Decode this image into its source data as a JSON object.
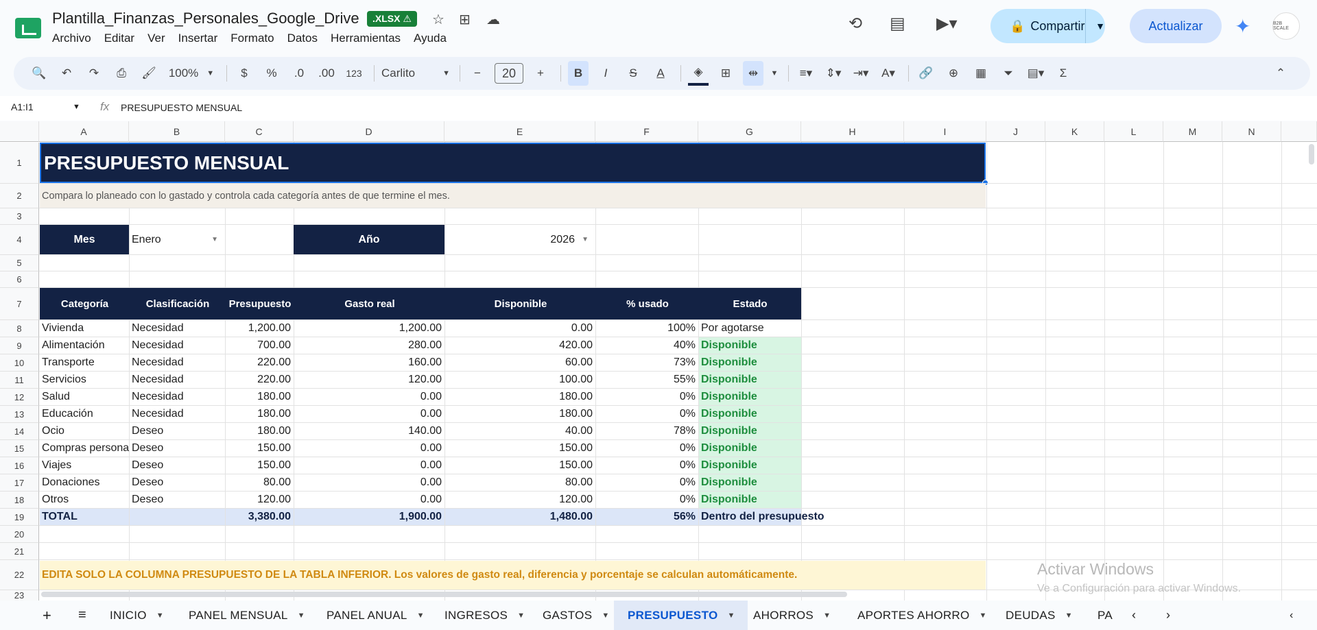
{
  "doc": {
    "title": "Plantilla_Finanzas_Personales_Google_Drive",
    "badge": ".XLSX ⚠"
  },
  "menu": [
    "Archivo",
    "Editar",
    "Ver",
    "Insertar",
    "Formato",
    "Datos",
    "Herramientas",
    "Ayuda"
  ],
  "header_buttons": {
    "share": "Compartir",
    "update": "Actualizar",
    "avatar": "B2B SCALE"
  },
  "toolbar": {
    "zoom": "100%",
    "currency": "$",
    "percent": "%",
    "dec_decrease": ".0",
    "dec_increase": ".00",
    "format_123": "123",
    "font": "Carlito",
    "font_size": "20"
  },
  "formula_bar": {
    "name_box": "A1:I1",
    "formula": "PRESUPUESTO MENSUAL"
  },
  "columns": [
    "A",
    "B",
    "C",
    "D",
    "E",
    "F",
    "G",
    "H",
    "I",
    "J",
    "K",
    "L",
    "M",
    "N"
  ],
  "rows": [
    "1",
    "2",
    "3",
    "4",
    "5",
    "6",
    "7",
    "8",
    "9",
    "10",
    "11",
    "12",
    "13",
    "14",
    "15",
    "16",
    "17",
    "18",
    "19",
    "20",
    "21",
    "22",
    "23"
  ],
  "sheet": {
    "title": "PRESUPUESTO MENSUAL",
    "subtitle": "Compara lo planeado con lo gastado y controla cada categoría antes de que termine el mes.",
    "mes_label": "Mes",
    "mes_value": "Enero",
    "anio_label": "Año",
    "anio_value": "2026",
    "table_headers": [
      "Categoría",
      "Clasificación",
      "Presupuesto",
      "Gasto real",
      "Disponible",
      "% usado",
      "Estado"
    ],
    "table_rows": [
      [
        "Vivienda",
        "Necesidad",
        "1,200.00",
        "1,200.00",
        "0.00",
        "100%",
        "Por agotarse"
      ],
      [
        "Alimentación",
        "Necesidad",
        "700.00",
        "280.00",
        "420.00",
        "40%",
        "Disponible"
      ],
      [
        "Transporte",
        "Necesidad",
        "220.00",
        "160.00",
        "60.00",
        "73%",
        "Disponible"
      ],
      [
        "Servicios",
        "Necesidad",
        "220.00",
        "120.00",
        "100.00",
        "55%",
        "Disponible"
      ],
      [
        "Salud",
        "Necesidad",
        "180.00",
        "0.00",
        "180.00",
        "0%",
        "Disponible"
      ],
      [
        "Educación",
        "Necesidad",
        "180.00",
        "0.00",
        "180.00",
        "0%",
        "Disponible"
      ],
      [
        "Ocio",
        "Deseo",
        "180.00",
        "140.00",
        "40.00",
        "78%",
        "Disponible"
      ],
      [
        "Compras personales",
        "Deseo",
        "150.00",
        "0.00",
        "150.00",
        "0%",
        "Disponible"
      ],
      [
        "Viajes",
        "Deseo",
        "150.00",
        "0.00",
        "150.00",
        "0%",
        "Disponible"
      ],
      [
        "Donaciones",
        "Deseo",
        "80.00",
        "0.00",
        "80.00",
        "0%",
        "Disponible"
      ],
      [
        "Otros",
        "Deseo",
        "120.00",
        "0.00",
        "120.00",
        "0%",
        "Disponible"
      ]
    ],
    "total_row": [
      "TOTAL",
      "",
      "3,380.00",
      "1,900.00",
      "1,480.00",
      "56%",
      "Dentro del presupuesto"
    ],
    "note": "EDITA SOLO LA COLUMNA PRESUPUESTO DE LA TABLA INFERIOR. Los valores de gasto real, diferencia y porcentaje se calculan automáticamente."
  },
  "watermark": {
    "line1": "Activar Windows",
    "line2": "Ve a Configuración para activar Windows."
  },
  "tabs": [
    "INICIO",
    "PANEL MENSUAL",
    "PANEL ANUAL",
    "INGRESOS",
    "GASTOS",
    "PRESUPUESTO",
    "AHORROS",
    "APORTES AHORRO",
    "DEUDAS",
    "PA"
  ],
  "active_tab": "PRESUPUESTO",
  "colors": {
    "navy": "#132244",
    "status_green_bg": "#d8f5e3",
    "status_green_text": "#1e8e3e",
    "total_bg": "#dce6f8",
    "note_bg": "#fef6d5",
    "note_text": "#d08a12",
    "subtitle_bg": "#f3efe8"
  }
}
